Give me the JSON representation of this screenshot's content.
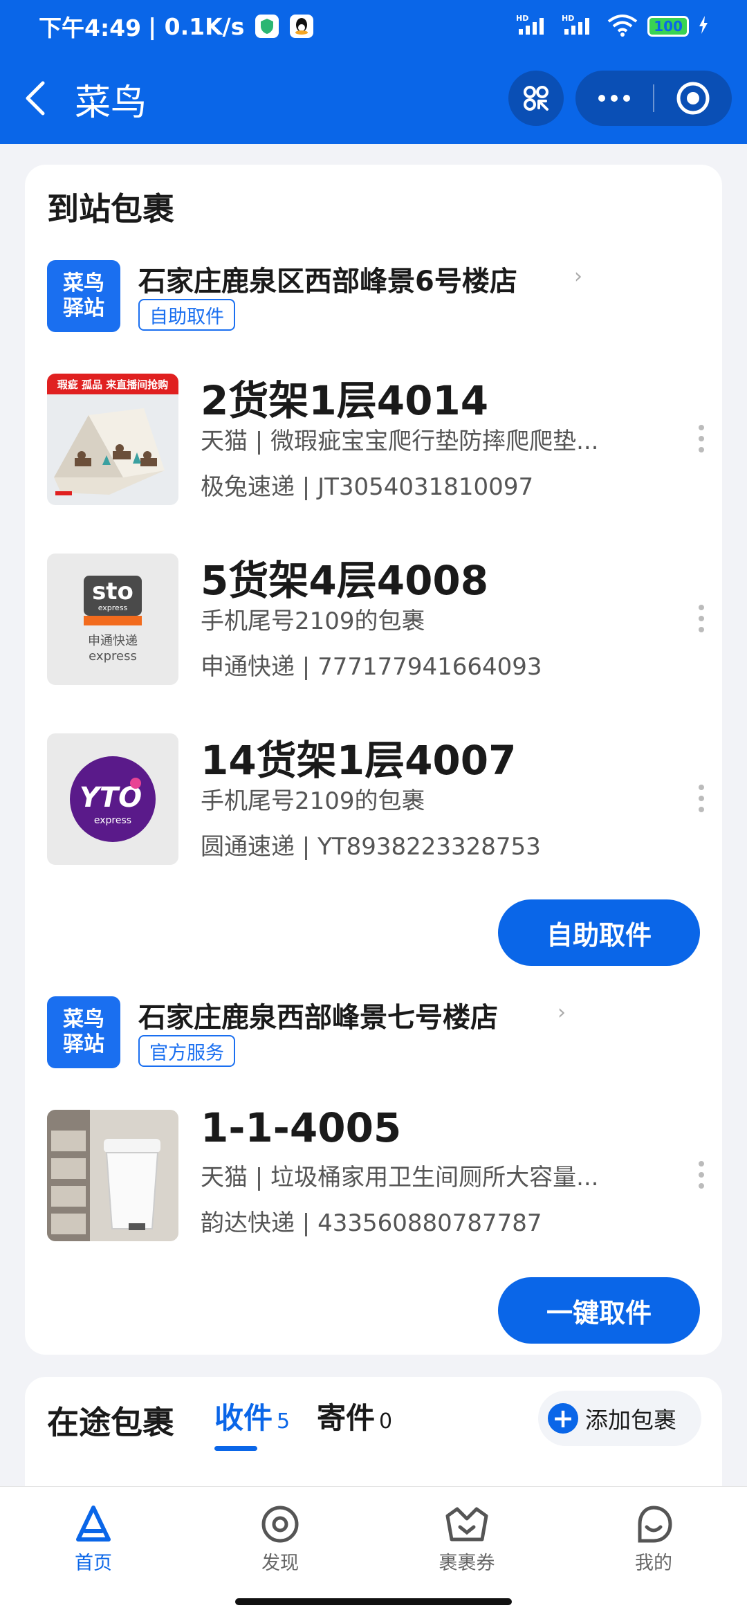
{
  "status_bar": {
    "time": "下午4:49",
    "speed": "| 0.1K/s",
    "network_1": "HD",
    "network_2": "HD",
    "battery": "100"
  },
  "nav": {
    "title": "菜鸟"
  },
  "arrived": {
    "title": "到站包裹",
    "stations": [
      {
        "logo_line1": "菜鸟",
        "logo_line2": "驿站",
        "name": "石家庄鹿泉区西部峰景6号楼店",
        "tag": "自助取件",
        "packages": [
          {
            "code": "2货架1层4014",
            "desc": "天猫 | 微瑕疵宝宝爬行垫防摔爬爬垫...",
            "tracking": "极兔速递 | JT3054031810097",
            "thumb_banner": "瑕疵 孤品 来直播间抢购"
          },
          {
            "code": "5货架4层4008",
            "desc": "手机尾号2109的包裹",
            "tracking": "申通快递 | 777177941664093",
            "thumb_logo": "sto",
            "thumb_logo_sub": "express",
            "thumb_cn": "申通快递",
            "thumb_en": "express"
          },
          {
            "code": "14货架1层4007",
            "desc": "手机尾号2109的包裹",
            "tracking": "圆通速递 | YT8938223328753",
            "thumb_logo": "YTO",
            "thumb_logo_sub": "express"
          }
        ],
        "action": "自助取件"
      },
      {
        "logo_line1": "菜鸟",
        "logo_line2": "驿站",
        "name": "石家庄鹿泉西部峰景七号楼店",
        "tag": "官方服务",
        "packages": [
          {
            "code": "1-1-4005",
            "desc": "天猫 | 垃圾桶家用卫生间厕所大容量...",
            "tracking": "韵达快递 | 433560880787787"
          }
        ],
        "action": "一键取件"
      }
    ]
  },
  "transit": {
    "title": "在途包裹",
    "tab_receive": "收件",
    "tab_receive_count": "5",
    "tab_send": "寄件",
    "tab_send_count": "0",
    "add_label": "添加包裹"
  },
  "tabbar": {
    "items": [
      {
        "label": "首页",
        "icon": "home-icon"
      },
      {
        "label": "发现",
        "icon": "discover-icon"
      },
      {
        "label": "裹裹券",
        "icon": "coupon-icon"
      },
      {
        "label": "我的",
        "icon": "profile-icon"
      }
    ]
  },
  "colors": {
    "brand": "#0a66e8",
    "text": "#1a1a1a",
    "muted": "#555555"
  }
}
